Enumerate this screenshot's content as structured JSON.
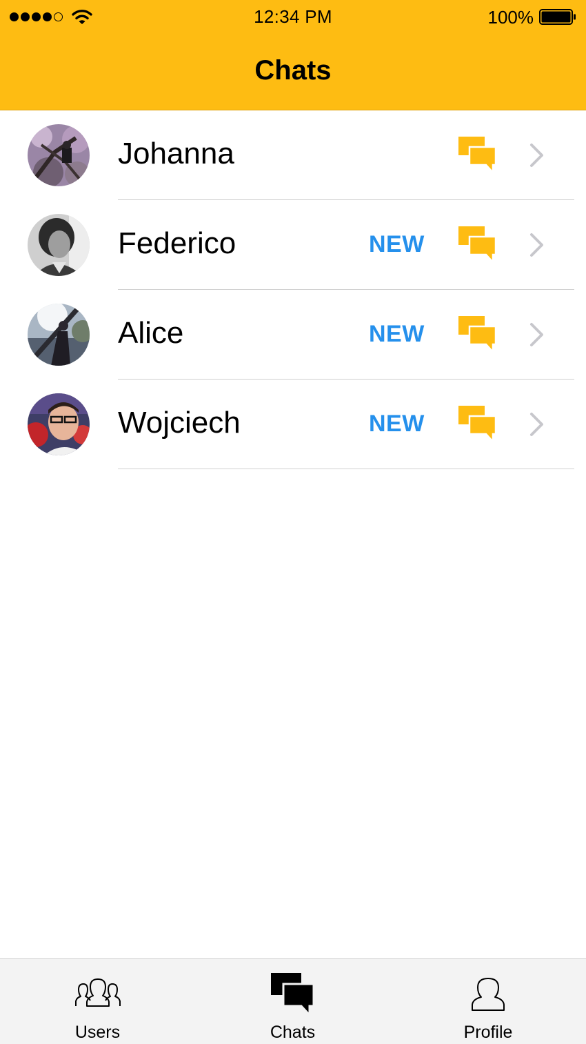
{
  "status_bar": {
    "time": "12:34 PM",
    "battery_percent": "100%",
    "signal_bars_filled": 4,
    "signal_bars_total": 5
  },
  "header": {
    "title": "Chats",
    "background_color": "#FEBC12"
  },
  "chats": [
    {
      "name": "Johanna",
      "badge": "",
      "icon": "chat-bubbles-icon"
    },
    {
      "name": "Federico",
      "badge": "NEW",
      "icon": "chat-bubbles-icon"
    },
    {
      "name": "Alice",
      "badge": "NEW",
      "icon": "chat-bubbles-icon"
    },
    {
      "name": "Wojciech",
      "badge": "NEW",
      "icon": "chat-bubbles-icon"
    }
  ],
  "colors": {
    "accent": "#FEBC12",
    "badge": "#2590EC",
    "chevron": "#c7c7cc"
  },
  "tab_bar": {
    "tabs": [
      {
        "label": "Users",
        "icon": "users-icon",
        "selected": false
      },
      {
        "label": "Chats",
        "icon": "chats-icon",
        "selected": true
      },
      {
        "label": "Profile",
        "icon": "profile-icon",
        "selected": false
      }
    ]
  }
}
